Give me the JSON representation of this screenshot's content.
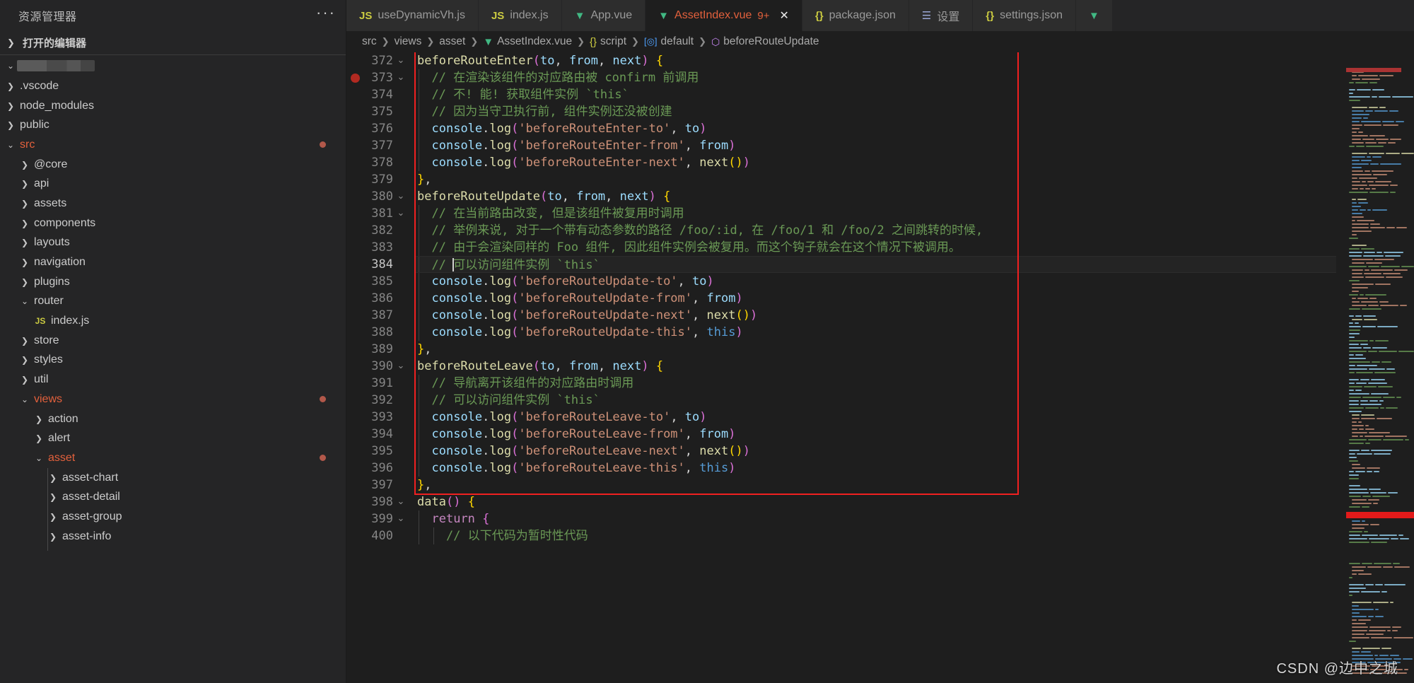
{
  "sidebar": {
    "header_title": "资源管理器",
    "more_icon": "ellipsis-icon",
    "open_editors_label": "打开的编辑器",
    "workspace_label": "",
    "items": [
      {
        "label": ".vscode",
        "depth": 1,
        "kind": "folder",
        "expanded": false,
        "modified": false,
        "dot": false
      },
      {
        "label": "node_modules",
        "depth": 1,
        "kind": "folder",
        "expanded": false,
        "modified": false,
        "dot": false
      },
      {
        "label": "public",
        "depth": 1,
        "kind": "folder",
        "expanded": false,
        "modified": false,
        "dot": false
      },
      {
        "label": "src",
        "depth": 1,
        "kind": "folder",
        "expanded": true,
        "modified": true,
        "dot": true
      },
      {
        "label": "@core",
        "depth": 2,
        "kind": "folder",
        "expanded": false,
        "modified": false,
        "dot": false
      },
      {
        "label": "api",
        "depth": 2,
        "kind": "folder",
        "expanded": false,
        "modified": false,
        "dot": false
      },
      {
        "label": "assets",
        "depth": 2,
        "kind": "folder",
        "expanded": false,
        "modified": false,
        "dot": false
      },
      {
        "label": "components",
        "depth": 2,
        "kind": "folder",
        "expanded": false,
        "modified": false,
        "dot": false
      },
      {
        "label": "layouts",
        "depth": 2,
        "kind": "folder",
        "expanded": false,
        "modified": false,
        "dot": false
      },
      {
        "label": "navigation",
        "depth": 2,
        "kind": "folder",
        "expanded": false,
        "modified": false,
        "dot": false
      },
      {
        "label": "plugins",
        "depth": 2,
        "kind": "folder",
        "expanded": false,
        "modified": false,
        "dot": false
      },
      {
        "label": "router",
        "depth": 2,
        "kind": "folder",
        "expanded": true,
        "modified": false,
        "dot": false
      },
      {
        "label": "index.js",
        "depth": 3,
        "kind": "js",
        "expanded": false,
        "modified": false,
        "dot": false
      },
      {
        "label": "store",
        "depth": 2,
        "kind": "folder",
        "expanded": false,
        "modified": false,
        "dot": false
      },
      {
        "label": "styles",
        "depth": 2,
        "kind": "folder",
        "expanded": false,
        "modified": false,
        "dot": false
      },
      {
        "label": "util",
        "depth": 2,
        "kind": "folder",
        "expanded": false,
        "modified": false,
        "dot": false
      },
      {
        "label": "views",
        "depth": 2,
        "kind": "folder",
        "expanded": true,
        "modified": true,
        "dot": true
      },
      {
        "label": "action",
        "depth": 3,
        "kind": "folder",
        "expanded": false,
        "modified": false,
        "dot": false
      },
      {
        "label": "alert",
        "depth": 3,
        "kind": "folder",
        "expanded": false,
        "modified": false,
        "dot": false
      },
      {
        "label": "asset",
        "depth": 3,
        "kind": "folder",
        "expanded": true,
        "modified": true,
        "dot": true
      },
      {
        "label": "asset-chart",
        "depth": 4,
        "kind": "folder",
        "expanded": false,
        "modified": false,
        "dot": false
      },
      {
        "label": "asset-detail",
        "depth": 4,
        "kind": "folder",
        "expanded": false,
        "modified": false,
        "dot": false
      },
      {
        "label": "asset-group",
        "depth": 4,
        "kind": "folder",
        "expanded": false,
        "modified": false,
        "dot": false
      },
      {
        "label": "asset-info",
        "depth": 4,
        "kind": "folder",
        "expanded": false,
        "modified": false,
        "dot": false
      }
    ]
  },
  "tabs": [
    {
      "label": "useDynamicVh.js",
      "icon": "js-icon",
      "active": false,
      "badge": "",
      "closable": false
    },
    {
      "label": "index.js",
      "icon": "js-icon",
      "active": false,
      "badge": "",
      "closable": false
    },
    {
      "label": "App.vue",
      "icon": "vue-icon",
      "active": false,
      "badge": "",
      "closable": false
    },
    {
      "label": "AssetIndex.vue",
      "icon": "vue-icon",
      "active": true,
      "badge": "9+",
      "closable": true
    },
    {
      "label": "package.json",
      "icon": "json-icon",
      "active": false,
      "badge": "",
      "closable": false
    },
    {
      "label": "设置",
      "icon": "gear-icon",
      "active": false,
      "badge": "",
      "closable": false
    },
    {
      "label": "settings.json",
      "icon": "json-icon",
      "active": false,
      "badge": "",
      "closable": false
    },
    {
      "label": "",
      "icon": "vue-icon",
      "active": false,
      "badge": "",
      "closable": false
    }
  ],
  "breadcrumb": [
    {
      "label": "src",
      "icon": ""
    },
    {
      "label": "views",
      "icon": ""
    },
    {
      "label": "asset",
      "icon": ""
    },
    {
      "label": "AssetIndex.vue",
      "icon": "vue-icon"
    },
    {
      "label": "script",
      "icon": "json-icon"
    },
    {
      "label": "default",
      "icon": "object-icon"
    },
    {
      "label": "beforeRouteUpdate",
      "icon": "method-icon"
    }
  ],
  "editor": {
    "first_line": 372,
    "cursor_line": 384,
    "breakpoint_line": 373,
    "fold_lines": [
      372,
      373,
      380,
      381,
      390,
      398,
      399
    ],
    "lines": [
      {
        "n": 372,
        "indent": 0,
        "tokens": [
          {
            "t": "fn",
            "v": "beforeRouteEnter"
          },
          {
            "t": "pn2",
            "v": "("
          },
          {
            "t": "var",
            "v": "to"
          },
          {
            "t": "plain",
            "v": ", "
          },
          {
            "t": "var",
            "v": "from"
          },
          {
            "t": "plain",
            "v": ", "
          },
          {
            "t": "var",
            "v": "next"
          },
          {
            "t": "pn2",
            "v": ")"
          },
          {
            "t": "plain",
            "v": " "
          },
          {
            "t": "pn1",
            "v": "{"
          }
        ]
      },
      {
        "n": 373,
        "indent": 1,
        "tokens": [
          {
            "t": "com",
            "v": "// 在渲染该组件的对应路由被 confirm 前调用"
          }
        ]
      },
      {
        "n": 374,
        "indent": 1,
        "tokens": [
          {
            "t": "com",
            "v": "// 不! 能! 获取组件实例 `this`"
          }
        ]
      },
      {
        "n": 375,
        "indent": 1,
        "tokens": [
          {
            "t": "com",
            "v": "// 因为当守卫执行前, 组件实例还没被创建"
          }
        ]
      },
      {
        "n": 376,
        "indent": 1,
        "tokens": [
          {
            "t": "var",
            "v": "console"
          },
          {
            "t": "plain",
            "v": "."
          },
          {
            "t": "fn",
            "v": "log"
          },
          {
            "t": "pn2",
            "v": "("
          },
          {
            "t": "str",
            "v": "'beforeRouteEnter-to'"
          },
          {
            "t": "plain",
            "v": ", "
          },
          {
            "t": "var",
            "v": "to"
          },
          {
            "t": "pn2",
            "v": ")"
          }
        ]
      },
      {
        "n": 377,
        "indent": 1,
        "tokens": [
          {
            "t": "var",
            "v": "console"
          },
          {
            "t": "plain",
            "v": "."
          },
          {
            "t": "fn",
            "v": "log"
          },
          {
            "t": "pn2",
            "v": "("
          },
          {
            "t": "str",
            "v": "'beforeRouteEnter-from'"
          },
          {
            "t": "plain",
            "v": ", "
          },
          {
            "t": "var",
            "v": "from"
          },
          {
            "t": "pn2",
            "v": ")"
          }
        ]
      },
      {
        "n": 378,
        "indent": 1,
        "tokens": [
          {
            "t": "var",
            "v": "console"
          },
          {
            "t": "plain",
            "v": "."
          },
          {
            "t": "fn",
            "v": "log"
          },
          {
            "t": "pn2",
            "v": "("
          },
          {
            "t": "str",
            "v": "'beforeRouteEnter-next'"
          },
          {
            "t": "plain",
            "v": ", "
          },
          {
            "t": "fn",
            "v": "next"
          },
          {
            "t": "pn1",
            "v": "()"
          },
          {
            "t": "pn2",
            "v": ")"
          }
        ]
      },
      {
        "n": 379,
        "indent": 0,
        "tokens": [
          {
            "t": "pn1",
            "v": "}"
          },
          {
            "t": "plain",
            "v": ","
          }
        ]
      },
      {
        "n": 380,
        "indent": 0,
        "tokens": [
          {
            "t": "fn",
            "v": "beforeRouteUpdate"
          },
          {
            "t": "pn2",
            "v": "("
          },
          {
            "t": "var",
            "v": "to"
          },
          {
            "t": "plain",
            "v": ", "
          },
          {
            "t": "var",
            "v": "from"
          },
          {
            "t": "plain",
            "v": ", "
          },
          {
            "t": "var",
            "v": "next"
          },
          {
            "t": "pn2",
            "v": ")"
          },
          {
            "t": "plain",
            "v": " "
          },
          {
            "t": "pn1",
            "v": "{"
          }
        ]
      },
      {
        "n": 381,
        "indent": 1,
        "tokens": [
          {
            "t": "com",
            "v": "// 在当前路由改变, 但是该组件被复用时调用"
          }
        ]
      },
      {
        "n": 382,
        "indent": 1,
        "tokens": [
          {
            "t": "com",
            "v": "// 举例来说, 对于一个带有动态参数的路径 /foo/:id, 在 /foo/1 和 /foo/2 之间跳转的时候,"
          }
        ]
      },
      {
        "n": 383,
        "indent": 1,
        "tokens": [
          {
            "t": "com",
            "v": "// 由于会渲染同样的 Foo 组件, 因此组件实例会被复用。而这个钩子就会在这个情况下被调用。"
          }
        ]
      },
      {
        "n": 384,
        "indent": 1,
        "tokens": [
          {
            "t": "com",
            "v": "// "
          },
          {
            "t": "cursor",
            "v": ""
          },
          {
            "t": "com",
            "v": "可以访问组件实例 `this`"
          }
        ]
      },
      {
        "n": 385,
        "indent": 1,
        "tokens": [
          {
            "t": "var",
            "v": "console"
          },
          {
            "t": "plain",
            "v": "."
          },
          {
            "t": "fn",
            "v": "log"
          },
          {
            "t": "pn2",
            "v": "("
          },
          {
            "t": "str",
            "v": "'beforeRouteUpdate-to'"
          },
          {
            "t": "plain",
            "v": ", "
          },
          {
            "t": "var",
            "v": "to"
          },
          {
            "t": "pn2",
            "v": ")"
          }
        ]
      },
      {
        "n": 386,
        "indent": 1,
        "tokens": [
          {
            "t": "var",
            "v": "console"
          },
          {
            "t": "plain",
            "v": "."
          },
          {
            "t": "fn",
            "v": "log"
          },
          {
            "t": "pn2",
            "v": "("
          },
          {
            "t": "str",
            "v": "'beforeRouteUpdate-from'"
          },
          {
            "t": "plain",
            "v": ", "
          },
          {
            "t": "var",
            "v": "from"
          },
          {
            "t": "pn2",
            "v": ")"
          }
        ]
      },
      {
        "n": 387,
        "indent": 1,
        "tokens": [
          {
            "t": "var",
            "v": "console"
          },
          {
            "t": "plain",
            "v": "."
          },
          {
            "t": "fn",
            "v": "log"
          },
          {
            "t": "pn2",
            "v": "("
          },
          {
            "t": "str",
            "v": "'beforeRouteUpdate-next'"
          },
          {
            "t": "plain",
            "v": ", "
          },
          {
            "t": "fn",
            "v": "next"
          },
          {
            "t": "pn1",
            "v": "()"
          },
          {
            "t": "pn2",
            "v": ")"
          }
        ]
      },
      {
        "n": 388,
        "indent": 1,
        "tokens": [
          {
            "t": "var",
            "v": "console"
          },
          {
            "t": "plain",
            "v": "."
          },
          {
            "t": "fn",
            "v": "log"
          },
          {
            "t": "pn2",
            "v": "("
          },
          {
            "t": "str",
            "v": "'beforeRouteUpdate-this'"
          },
          {
            "t": "plain",
            "v": ", "
          },
          {
            "t": "this",
            "v": "this"
          },
          {
            "t": "pn2",
            "v": ")"
          }
        ]
      },
      {
        "n": 389,
        "indent": 0,
        "tokens": [
          {
            "t": "pn1",
            "v": "}"
          },
          {
            "t": "plain",
            "v": ","
          }
        ]
      },
      {
        "n": 390,
        "indent": 0,
        "tokens": [
          {
            "t": "fn",
            "v": "beforeRouteLeave"
          },
          {
            "t": "pn2",
            "v": "("
          },
          {
            "t": "var",
            "v": "to"
          },
          {
            "t": "plain",
            "v": ", "
          },
          {
            "t": "var",
            "v": "from"
          },
          {
            "t": "plain",
            "v": ", "
          },
          {
            "t": "var",
            "v": "next"
          },
          {
            "t": "pn2",
            "v": ")"
          },
          {
            "t": "plain",
            "v": " "
          },
          {
            "t": "pn1",
            "v": "{"
          }
        ]
      },
      {
        "n": 391,
        "indent": 1,
        "tokens": [
          {
            "t": "com",
            "v": "// 导航离开该组件的对应路由时调用"
          }
        ]
      },
      {
        "n": 392,
        "indent": 1,
        "tokens": [
          {
            "t": "com",
            "v": "// 可以访问组件实例 `this`"
          }
        ]
      },
      {
        "n": 393,
        "indent": 1,
        "tokens": [
          {
            "t": "var",
            "v": "console"
          },
          {
            "t": "plain",
            "v": "."
          },
          {
            "t": "fn",
            "v": "log"
          },
          {
            "t": "pn2",
            "v": "("
          },
          {
            "t": "str",
            "v": "'beforeRouteLeave-to'"
          },
          {
            "t": "plain",
            "v": ", "
          },
          {
            "t": "var",
            "v": "to"
          },
          {
            "t": "pn2",
            "v": ")"
          }
        ]
      },
      {
        "n": 394,
        "indent": 1,
        "tokens": [
          {
            "t": "var",
            "v": "console"
          },
          {
            "t": "plain",
            "v": "."
          },
          {
            "t": "fn",
            "v": "log"
          },
          {
            "t": "pn2",
            "v": "("
          },
          {
            "t": "str",
            "v": "'beforeRouteLeave-from'"
          },
          {
            "t": "plain",
            "v": ", "
          },
          {
            "t": "var",
            "v": "from"
          },
          {
            "t": "pn2",
            "v": ")"
          }
        ]
      },
      {
        "n": 395,
        "indent": 1,
        "tokens": [
          {
            "t": "var",
            "v": "console"
          },
          {
            "t": "plain",
            "v": "."
          },
          {
            "t": "fn",
            "v": "log"
          },
          {
            "t": "pn2",
            "v": "("
          },
          {
            "t": "str",
            "v": "'beforeRouteLeave-next'"
          },
          {
            "t": "plain",
            "v": ", "
          },
          {
            "t": "fn",
            "v": "next"
          },
          {
            "t": "pn1",
            "v": "()"
          },
          {
            "t": "pn2",
            "v": ")"
          }
        ]
      },
      {
        "n": 396,
        "indent": 1,
        "tokens": [
          {
            "t": "var",
            "v": "console"
          },
          {
            "t": "plain",
            "v": "."
          },
          {
            "t": "fn",
            "v": "log"
          },
          {
            "t": "pn2",
            "v": "("
          },
          {
            "t": "str",
            "v": "'beforeRouteLeave-this'"
          },
          {
            "t": "plain",
            "v": ", "
          },
          {
            "t": "this",
            "v": "this"
          },
          {
            "t": "pn2",
            "v": ")"
          }
        ]
      },
      {
        "n": 397,
        "indent": 0,
        "tokens": [
          {
            "t": "pn1",
            "v": "}"
          },
          {
            "t": "plain",
            "v": ","
          }
        ]
      },
      {
        "n": 398,
        "indent": 0,
        "tokens": [
          {
            "t": "fn",
            "v": "data"
          },
          {
            "t": "pn2",
            "v": "()"
          },
          {
            "t": "plain",
            "v": " "
          },
          {
            "t": "pn1",
            "v": "{"
          }
        ]
      },
      {
        "n": 399,
        "indent": 1,
        "tokens": [
          {
            "t": "kw",
            "v": "return"
          },
          {
            "t": "plain",
            "v": " "
          },
          {
            "t": "pn2",
            "v": "{"
          }
        ]
      },
      {
        "n": 400,
        "indent": 2,
        "tokens": [
          {
            "t": "com",
            "v": "// 以下代码为暂时性代码"
          }
        ]
      }
    ]
  },
  "watermark": "CSDN @边中之城",
  "colors": {
    "accent_modified": "#e2603c",
    "vue_green": "#41b883",
    "js_yellow": "#cbcb41",
    "comment_green": "#6a9955",
    "string_orange": "#ce9178",
    "highlight_red": "#f02020",
    "breakpoint_red": "#b22a21",
    "editor_bg": "#1e1e1e",
    "sidebar_bg": "#252526"
  }
}
